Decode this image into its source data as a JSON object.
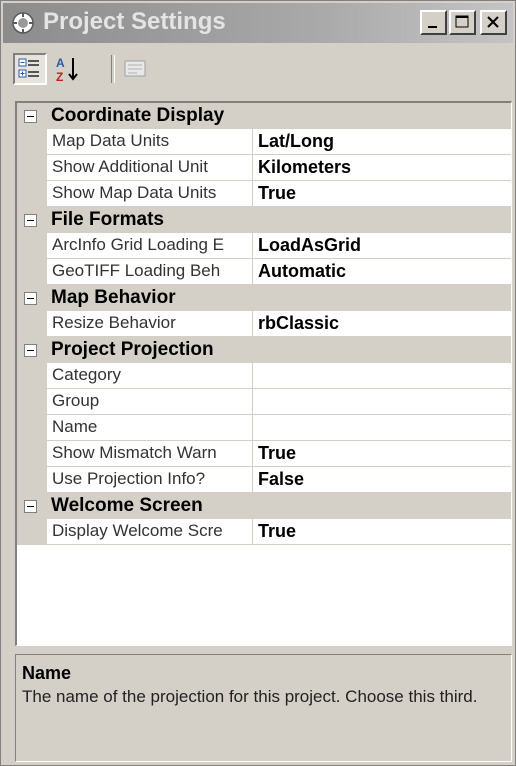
{
  "window": {
    "title": "Project Settings",
    "icon": "gear-globe-icon"
  },
  "caption_buttons": [
    {
      "name": "minimize",
      "icon": "minimize-icon"
    },
    {
      "name": "maximize",
      "icon": "maximize-icon"
    },
    {
      "name": "close",
      "icon": "close-icon"
    }
  ],
  "toolbar": [
    {
      "name": "categorized",
      "icon": "categorized-icon",
      "pressed": true
    },
    {
      "name": "alphabetical",
      "icon": "sort-az-icon",
      "pressed": false
    },
    {
      "name": "property-pages",
      "icon": "property-pages-icon",
      "pressed": false,
      "disabled": true
    }
  ],
  "grid": {
    "categories": [
      {
        "label": "Coordinate Display",
        "expanded": true,
        "properties": [
          {
            "name": "Map Data Units",
            "value": "Lat/Long"
          },
          {
            "name": "Show Additional Unit",
            "value": "Kilometers"
          },
          {
            "name": "Show Map Data Units",
            "value": "True"
          }
        ]
      },
      {
        "label": "File Formats",
        "expanded": true,
        "properties": [
          {
            "name": "ArcInfo Grid Loading E",
            "value": "LoadAsGrid"
          },
          {
            "name": "GeoTIFF Loading Beh",
            "value": "Automatic"
          }
        ]
      },
      {
        "label": "Map Behavior",
        "expanded": true,
        "properties": [
          {
            "name": "Resize Behavior",
            "value": "rbClassic"
          }
        ]
      },
      {
        "label": "Project Projection",
        "expanded": true,
        "properties": [
          {
            "name": "Category",
            "value": ""
          },
          {
            "name": "Group",
            "value": ""
          },
          {
            "name": "Name",
            "value": ""
          },
          {
            "name": "Show Mismatch Warn",
            "value": "True"
          },
          {
            "name": "Use Projection Info?",
            "value": "False"
          }
        ]
      },
      {
        "label": "Welcome Screen",
        "expanded": true,
        "properties": [
          {
            "name": "Display Welcome Scre",
            "value": "True"
          }
        ]
      }
    ]
  },
  "description": {
    "title": "Name",
    "text": "The name of the projection for this project. Choose this third."
  },
  "colors": {
    "face": "#d4d0c8",
    "title_gradient_start": "#8c8c8c",
    "title_gradient_end": "#c4c4c4"
  }
}
